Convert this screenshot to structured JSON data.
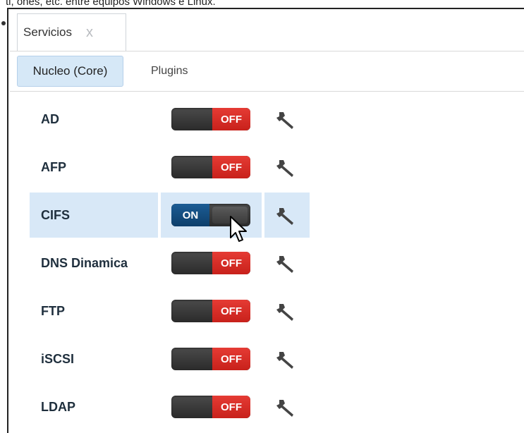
{
  "caption": "ti, ones, etc. entre equipos Windows e Linux.",
  "tabs": [
    {
      "label": "Servicios",
      "close": "x"
    }
  ],
  "subnav": {
    "active": "Nucleo (Core)",
    "other": "Plugins"
  },
  "services": [
    {
      "name": "AD",
      "state": "OFF",
      "on": false
    },
    {
      "name": "AFP",
      "state": "OFF",
      "on": false
    },
    {
      "name": "CIFS",
      "state": "ON",
      "on": true,
      "selected": true
    },
    {
      "name": "DNS Dinamica",
      "state": "OFF",
      "on": false
    },
    {
      "name": "FTP",
      "state": "OFF",
      "on": false
    },
    {
      "name": "iSCSI",
      "state": "OFF",
      "on": false
    },
    {
      "name": "LDAP",
      "state": "OFF",
      "on": false
    }
  ],
  "colors": {
    "off": "#d8261f",
    "on": "#135089",
    "selected_row": "#d8e8f7",
    "active_subtab": "#d6e8f7"
  },
  "icons": {
    "service_settings": "wrench-icon",
    "tab_close": "close-icon",
    "pointer": "mouse-cursor-icon"
  }
}
